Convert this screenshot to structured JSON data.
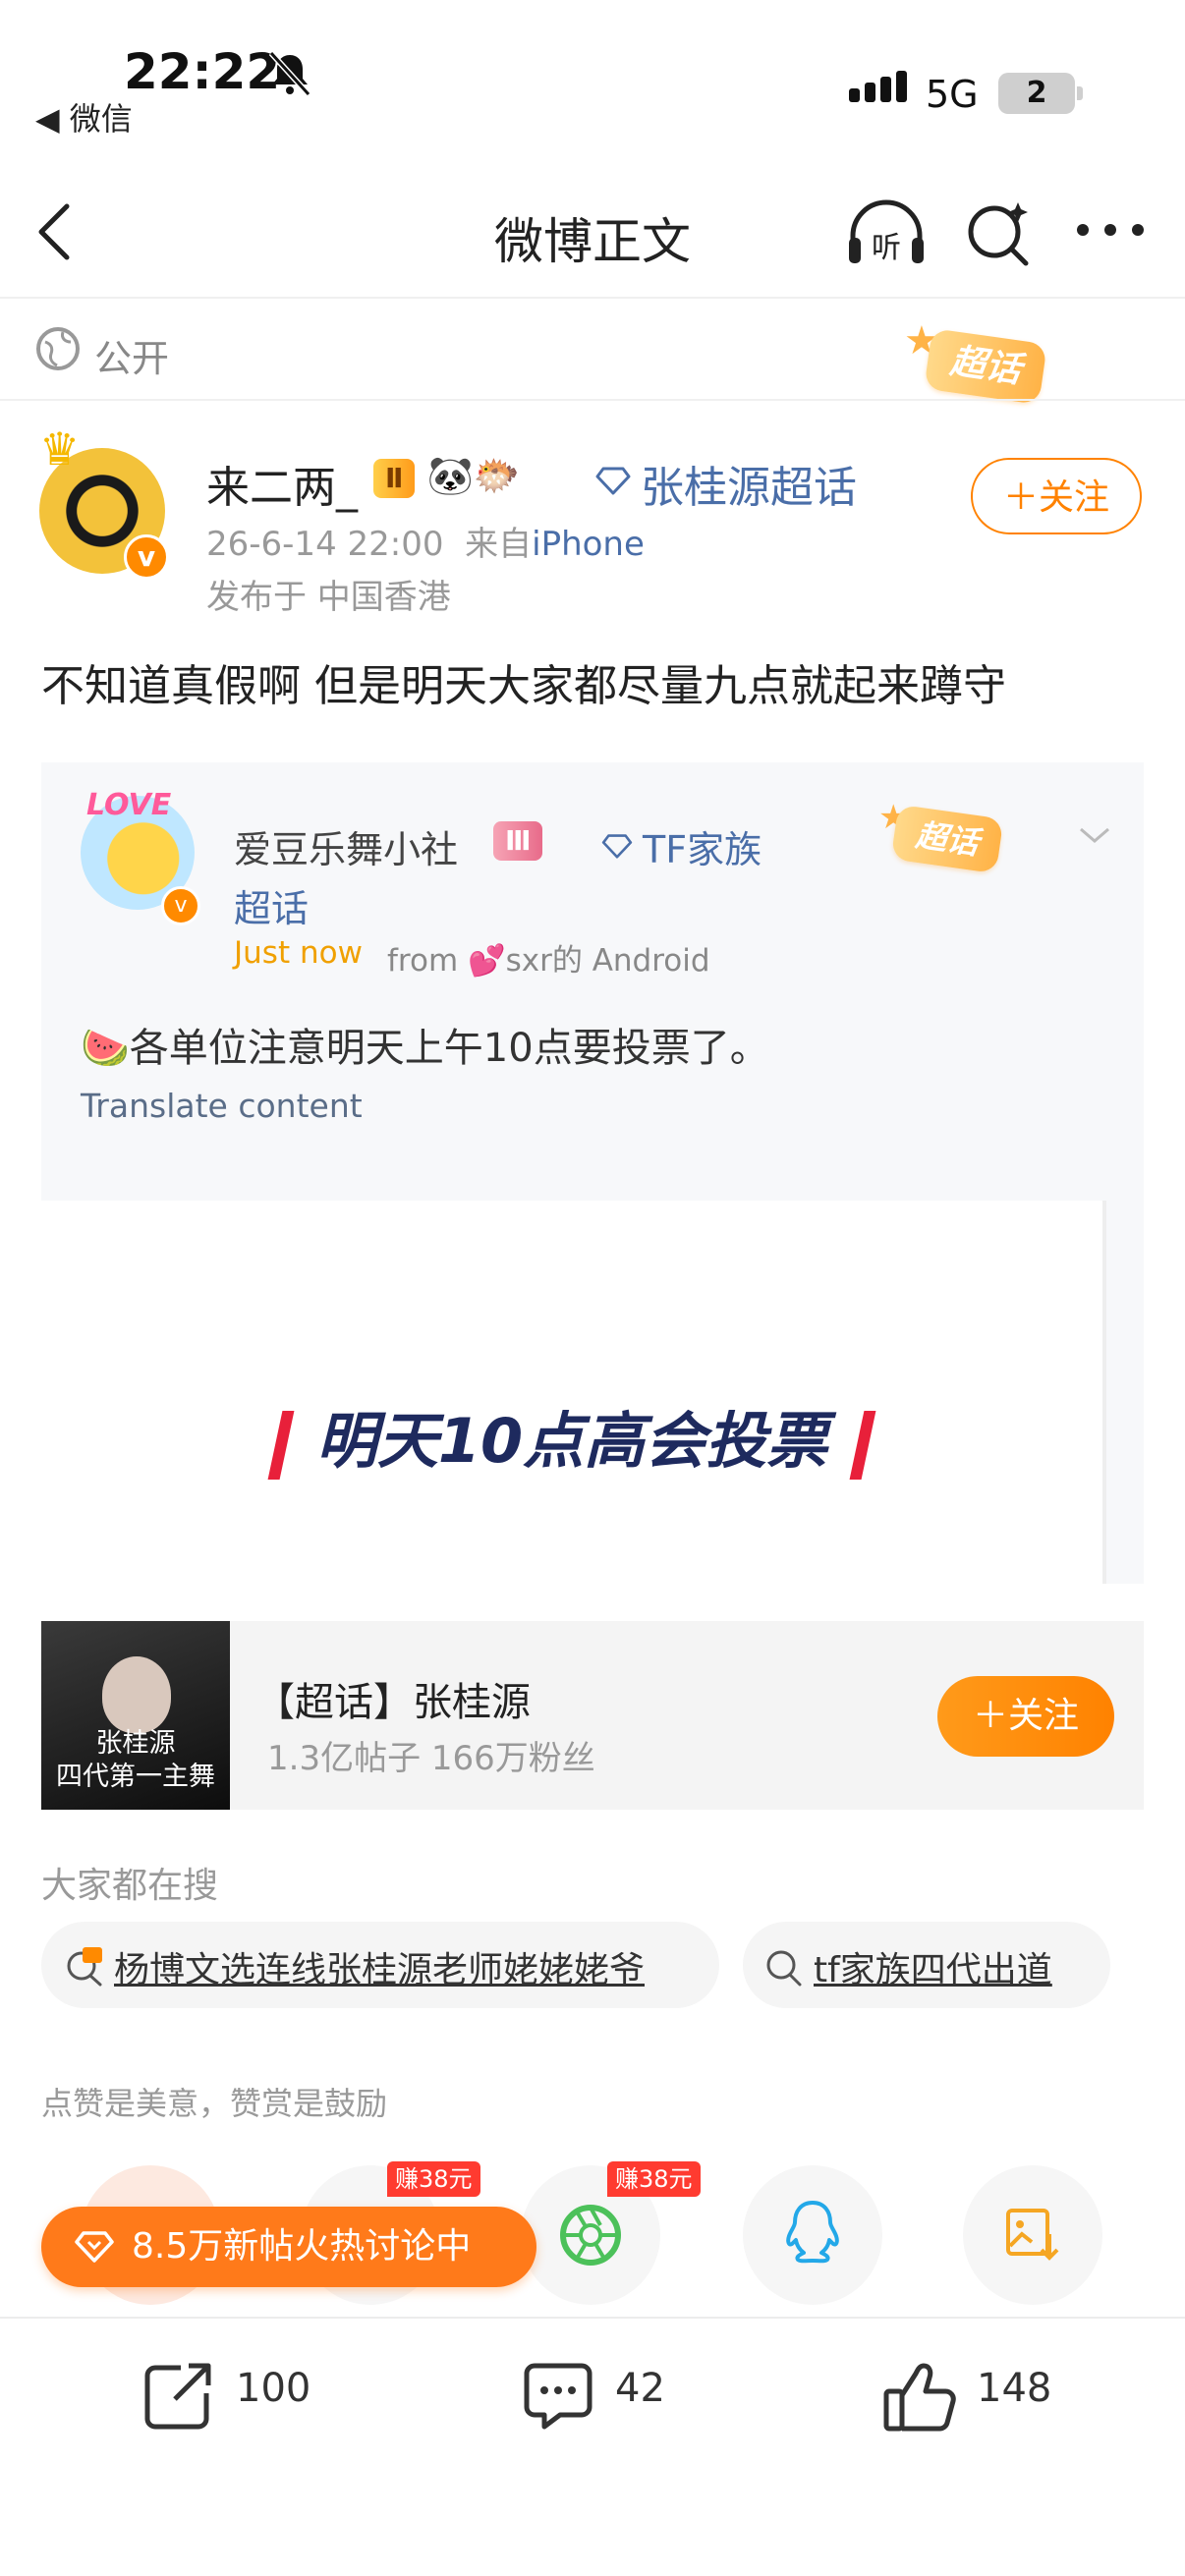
{
  "status_bar": {
    "time": "22:22",
    "back_app": "◀ 微信",
    "network": "5G",
    "battery": "2"
  },
  "nav": {
    "title": "微博正文",
    "listen_icon": "headphones-listen-icon",
    "search_icon": "sparkle-search-icon",
    "more_icon": "more-dots-icon"
  },
  "visibility": {
    "label": "公开",
    "topic_badge": "超话"
  },
  "author": {
    "name": "来二两_",
    "level_badge": "Ⅱ",
    "emoji": "🐼🐡",
    "super_topic": "张桂源超话",
    "time": "26-6-14 22:00",
    "source_prefix": "来自",
    "source": "iPhone",
    "location": "发布于 中国香港",
    "follow_label": "＋关注",
    "verified": "v"
  },
  "post": {
    "text": "不知道真假啊 但是明天大家都尽量九点就起来蹲守"
  },
  "quoted": {
    "avatar_tag": "LOVE",
    "name": "爱豆乐舞小社",
    "level_badge": "Ⅲ",
    "topic_line1": "TF家族",
    "topic_line2": "超话",
    "badge": "超话",
    "time": "Just now",
    "from": "from 💕sxr的 Android",
    "text": "🍉各单位注意明天上午10点要投票了。",
    "translate": "Translate content",
    "poster_text": "明天10点高会投票"
  },
  "topic_card": {
    "title": "【超话】张桂源",
    "stats": "1.3亿帖子 166万粉丝",
    "follow_label": "＋关注",
    "cover_text": "张桂源\n四代第一主舞"
  },
  "search": {
    "heading": "大家都在搜",
    "items": [
      {
        "text": "杨博文选连线张桂源老师姥姥姥爷",
        "icon": "hot-search-icon"
      },
      {
        "text": "tf家族四代出道",
        "icon": "search-icon"
      }
    ]
  },
  "reward": {
    "label": "点赞是美意，赞赏是鼓励",
    "earn_tag_1": "赚38元",
    "earn_tag_2": "赚38元",
    "hot_banner": "8.5万新帖火热讨论中"
  },
  "actions": {
    "repost_count": "100",
    "comment_count": "42",
    "like_count": "148"
  },
  "colors": {
    "accent_orange": "#ff8200",
    "link_blue": "#4a6ea8"
  }
}
